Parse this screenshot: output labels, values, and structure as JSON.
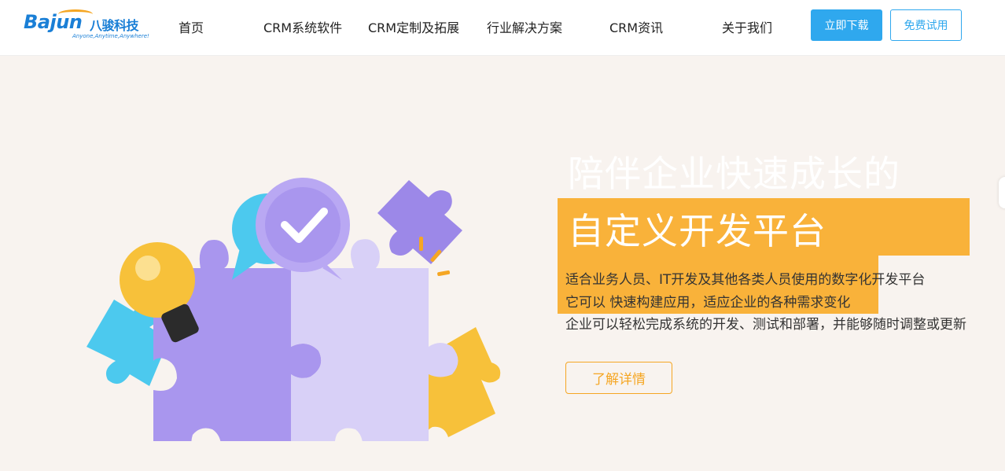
{
  "brand": {
    "latin": "Bajun",
    "chinese": "八骏科技",
    "tagline": "Anyone,Anytime,Anywhere!",
    "color": "#1a7fd6"
  },
  "nav": {
    "items": [
      {
        "label": "首页"
      },
      {
        "label": "CRM系统软件"
      },
      {
        "label": "CRM定制及拓展"
      },
      {
        "label": "行业解决方案"
      },
      {
        "label": "CRM资讯"
      },
      {
        "label": "关于我们"
      }
    ],
    "download_label": "立即下载",
    "trial_label": "免费试用"
  },
  "hero": {
    "headline_line1": "陪伴企业快速成长的",
    "headline_line2": "自定义开发平台",
    "desc_line1": "适合业务人员、IT开发及其他各类人员使用的数字化开发平台",
    "desc_line2": "它可以 快速构建应用，适应企业的各种需求变化",
    "desc_line3": "企业可以轻松完成系统的开发、测试和部署，并能够随时调整或更新",
    "cta_label": "了解详情",
    "accent": "#f9b23a",
    "background": "#f8f3ef"
  },
  "colors": {
    "primary": "#2fa8ee",
    "orange": "#f5a623",
    "purple": "#a996ee",
    "light_purple": "#d8d0f7",
    "cyan": "#4cc9ee",
    "yellow": "#f7c13a"
  },
  "icons": {
    "illustration": "puzzle-pieces-lightbulb-check-illustration",
    "check": "check-icon",
    "bulb": "lightbulb-icon"
  }
}
